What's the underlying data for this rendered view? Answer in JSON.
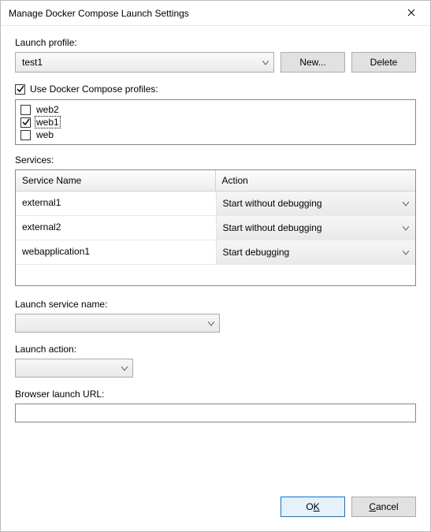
{
  "window": {
    "title": "Manage Docker Compose Launch Settings"
  },
  "labels": {
    "launch_profile": "Launch profile:",
    "use_profiles": "Use Docker Compose profiles:",
    "services": "Services:",
    "col_service_name": "Service Name",
    "col_action": "Action",
    "launch_service_name": "Launch service name:",
    "launch_action": "Launch action:",
    "browser_launch_url": "Browser launch URL:"
  },
  "profile_select": {
    "value": "test1"
  },
  "buttons": {
    "new": "New...",
    "delete": "Delete",
    "ok_pre": "O",
    "ok_ul": "K",
    "ok_post": "",
    "cancel_pre": "",
    "cancel_ul": "C",
    "cancel_post": "ancel"
  },
  "use_profiles_checked": true,
  "compose_profiles": [
    {
      "label": "web2",
      "checked": false,
      "focus": false
    },
    {
      "label": "web1",
      "checked": true,
      "focus": true
    },
    {
      "label": "web",
      "checked": false,
      "focus": false
    }
  ],
  "services_rows": [
    {
      "name": "external1",
      "action": "Start without debugging"
    },
    {
      "name": "external2",
      "action": "Start without debugging"
    },
    {
      "name": "webapplication1",
      "action": "Start debugging"
    }
  ],
  "launch_service_name": "",
  "launch_action": "",
  "browser_url": ""
}
